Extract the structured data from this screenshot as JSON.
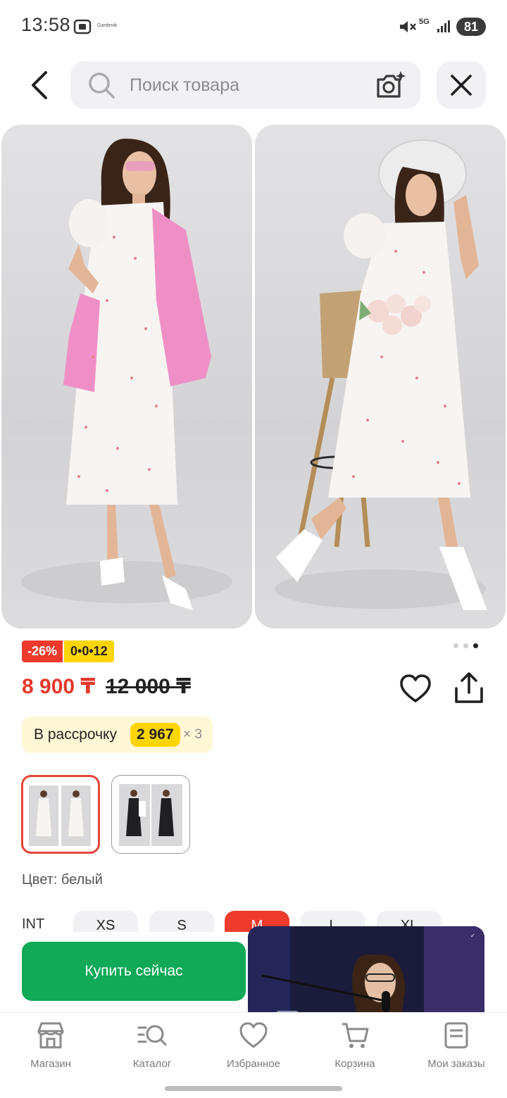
{
  "status_bar": {
    "time": "13:58",
    "small_text": "Gardenik",
    "network": "5G",
    "battery": "81"
  },
  "search": {
    "placeholder": "Поиск товара"
  },
  "product": {
    "discount": "-26%",
    "installment_badge": "0•0•12",
    "price": "8 900 ₸",
    "old_price": "12 000 ₸",
    "installment": {
      "label": "В рассрочку",
      "amount": "2 967",
      "times": "× 3"
    },
    "color_label": "Цвет: белый",
    "gallery_pages": 3,
    "gallery_active_page": 3
  },
  "sizes": {
    "label": "INT",
    "options": [
      "XS",
      "S",
      "M",
      "L",
      "XL"
    ],
    "selected": "M"
  },
  "buy_button": {
    "label": "Купить сейчас"
  },
  "bottom_nav": [
    {
      "label": "Магазин",
      "icon": "shop-icon"
    },
    {
      "label": "Каталог",
      "icon": "catalog-search-icon"
    },
    {
      "label": "Избранное",
      "icon": "heart-icon"
    },
    {
      "label": "Корзина",
      "icon": "cart-icon"
    },
    {
      "label": "Мои заказы",
      "icon": "orders-icon"
    }
  ],
  "colors": {
    "accent_red": "#e5382a",
    "buy_green": "#0fa957",
    "badge_yellow": "#ffd500"
  }
}
